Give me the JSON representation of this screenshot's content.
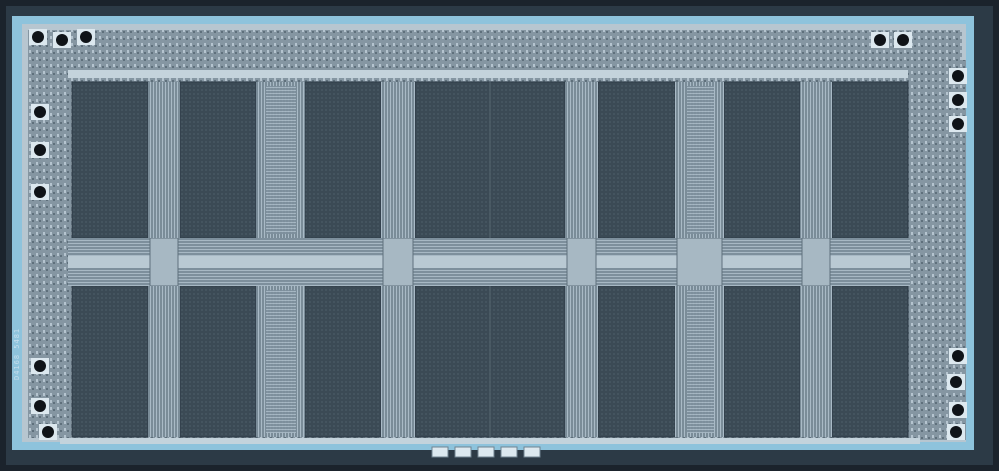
{
  "die": {
    "edge_color": "#8fc3dc",
    "frame_color": "#a9d6ea",
    "array_color": "#3d4d59",
    "logic_color": "#8fa0ac",
    "label_text": "D4168 5481"
  },
  "memory_blocks": {
    "rows": 2,
    "columns": 7,
    "description_none": ""
  },
  "bond_pads": {
    "left_count": 6,
    "right_count": 7,
    "bottom_count": 5,
    "top_left_count": 3,
    "top_right_count": 2
  }
}
